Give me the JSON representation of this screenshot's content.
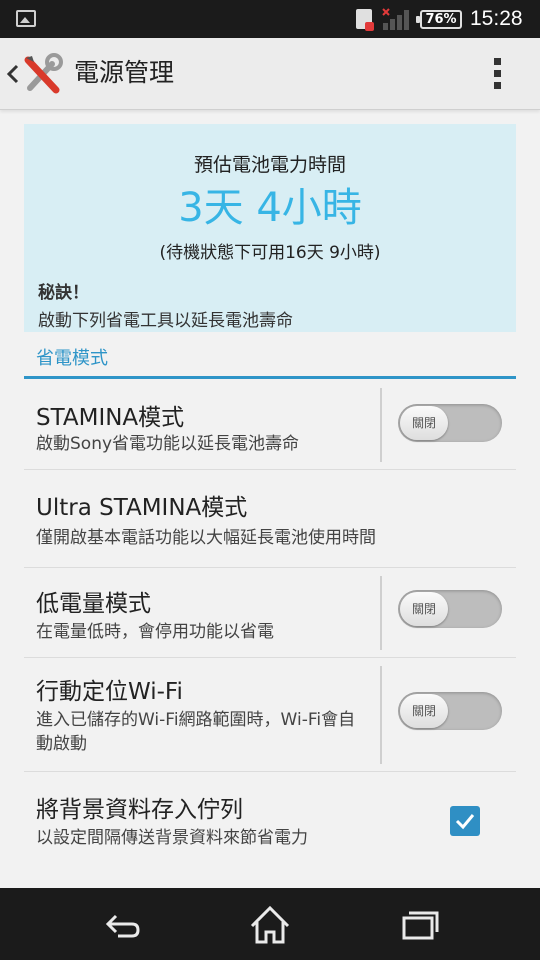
{
  "status_bar": {
    "battery_percent": "76%",
    "time": "15:28",
    "icons": [
      "gallery-icon",
      "sim-error-icon",
      "signal-icon",
      "battery-icon"
    ]
  },
  "action_bar": {
    "title": "電源管理",
    "icons": [
      "back-chevron-icon",
      "tools-icon",
      "overflow-menu-icon"
    ]
  },
  "battery_card": {
    "label": "預估電池電力時間",
    "time": "3天 4小時",
    "standby": "(待機狀態下可用16天 9小時)",
    "tip_title": "秘訣！",
    "tip_desc": "啟動下列省電工具以延長電池壽命",
    "accent_color": "#37b5e5",
    "bg_color": "#d8eef4"
  },
  "section": {
    "title": "省電模式",
    "accent_color": "#2f95c8"
  },
  "settings": [
    {
      "title": "STAMINA模式",
      "desc": "啟動Sony省電功能以延長電池壽命",
      "control": "toggle",
      "state": "關閉"
    },
    {
      "title": "Ultra STAMINA模式",
      "desc": "僅開啟基本電話功能以大幅延長電池使用時間",
      "control": "none"
    },
    {
      "title": "低電量模式",
      "desc": "在電量低時，會停用功能以省電",
      "control": "toggle",
      "state": "關閉"
    },
    {
      "title": "行動定位Wi-Fi",
      "desc": "進入已儲存的Wi-Fi網路範圍時，Wi-Fi會自動啟動",
      "control": "toggle",
      "state": "關閉"
    },
    {
      "title": "將背景資料存入佇列",
      "desc": "以設定間隔傳送背景資料來節省電力",
      "control": "checkbox",
      "checked": true
    }
  ],
  "nav_bar": {
    "icons": [
      "back-icon",
      "home-icon",
      "recent-apps-icon"
    ]
  }
}
